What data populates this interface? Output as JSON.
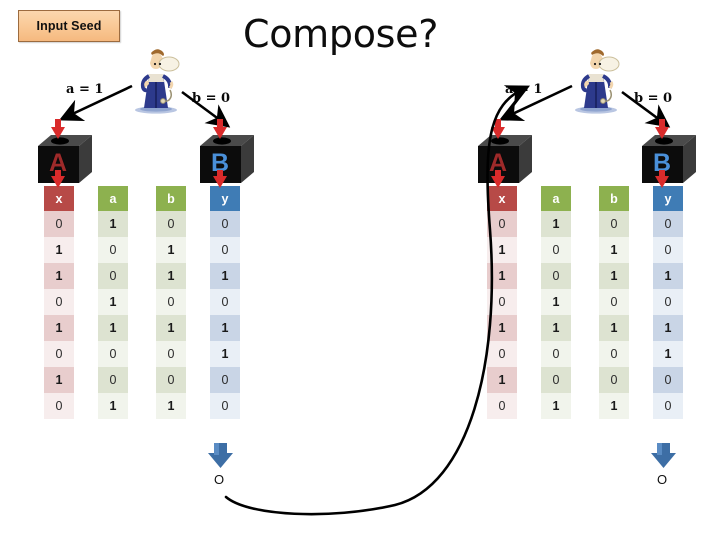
{
  "page": {
    "title": "Compose?",
    "background": "#ffffff"
  },
  "callout": {
    "label": "Input Seed",
    "fill": "#f9c794",
    "border": "#9c6b3f"
  },
  "icons": {
    "magician": "magician-figure-icon",
    "black_box": "black-box-cube-icon",
    "red_arrow_in": "red-arrow-down-icon",
    "red_arrow_out": "red-arrow-down-icon",
    "blue_arrow_out": "blue-arrow-down-icon",
    "curved_arrow": "curved-feedback-arrow-icon"
  },
  "colors": {
    "header_x": "#b74a47",
    "header_a": "#8db14f",
    "header_b": "#8db14f",
    "header_y": "#3f7cb5",
    "letter_a": "#9e2a2a",
    "letter_b": "#4a90d9",
    "blue_arrow": "#3d6ea5",
    "red_arrow": "#d92b2b",
    "curve": "#000000"
  },
  "left_group": {
    "name": "left-diagram",
    "edge_labels": [
      {
        "text": "a = 1"
      },
      {
        "text": "b = 0"
      }
    ],
    "boxes": [
      {
        "letter": "A",
        "color": "#9e2a2a"
      },
      {
        "letter": "B",
        "color": "#4a90d9"
      }
    ],
    "output_symbol": "O",
    "table": {
      "headers": [
        "x",
        "a",
        "b",
        "y"
      ],
      "rows": [
        [
          "0",
          "1",
          "0",
          "0"
        ],
        [
          "1",
          "0",
          "1",
          "0"
        ],
        [
          "1",
          "0",
          "1",
          "1"
        ],
        [
          "0",
          "1",
          "0",
          "0"
        ],
        [
          "1",
          "1",
          "1",
          "1"
        ],
        [
          "0",
          "0",
          "0",
          "1"
        ],
        [
          "1",
          "0",
          "0",
          "0"
        ],
        [
          "0",
          "1",
          "1",
          "0"
        ]
      ]
    }
  },
  "right_group": {
    "name": "right-diagram",
    "edge_labels": [
      {
        "text": "a = 1"
      },
      {
        "text": "b = 0"
      }
    ],
    "boxes": [
      {
        "letter": "A",
        "color": "#9e2a2a"
      },
      {
        "letter": "B",
        "color": "#4a90d9"
      }
    ],
    "output_symbol": "O",
    "table": {
      "headers": [
        "x",
        "a",
        "b",
        "y"
      ],
      "rows": [
        [
          "0",
          "1",
          "0",
          "0"
        ],
        [
          "1",
          "0",
          "1",
          "0"
        ],
        [
          "1",
          "0",
          "1",
          "1"
        ],
        [
          "0",
          "1",
          "0",
          "0"
        ],
        [
          "1",
          "1",
          "1",
          "1"
        ],
        [
          "0",
          "0",
          "0",
          "1"
        ],
        [
          "1",
          "0",
          "0",
          "0"
        ],
        [
          "0",
          "1",
          "1",
          "0"
        ]
      ]
    }
  }
}
